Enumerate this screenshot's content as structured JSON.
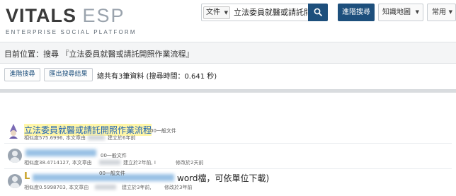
{
  "header": {
    "logo_main_left": "VITALS",
    "logo_main_right": "ESP",
    "logo_sub": "ENTERPRISE SOCIAL PLATFORM",
    "search_scope": "文件",
    "search_query": "立法委員就醫或請託開",
    "advanced_search": "進階搜尋",
    "knowledge_map": "知識地圖",
    "common": "常用"
  },
  "breadcrumb": {
    "text": "目前位置：搜尋 『立法委員就醫或請託開照作業流程』"
  },
  "actions": {
    "advanced_search": "進階搜尋",
    "export_results": "匯出搜尋結果",
    "summary": "總共有3筆資料 (搜尋時間：0.641 秒)"
  },
  "results": [
    {
      "title": "立法委員就醫或請託開照作業流程",
      "doc_type": "00一般文件",
      "meta_left": "相似度575.6996, 本文章由",
      "meta_right": "建立於6年前"
    },
    {
      "title": "",
      "doc_type": "00一般文件",
      "meta_left": "相似度38.4714127, 本文章由",
      "meta_mid": "建立於2年前, I",
      "meta_right": "修改於2天前"
    },
    {
      "title": "word檔，可依單位下載)",
      "doc_type": "00一般文件",
      "meta_left": "相似度0.5998703, 本文章由",
      "meta_mid": "建立於3年前,",
      "meta_right": "修改於3年前"
    }
  ]
}
